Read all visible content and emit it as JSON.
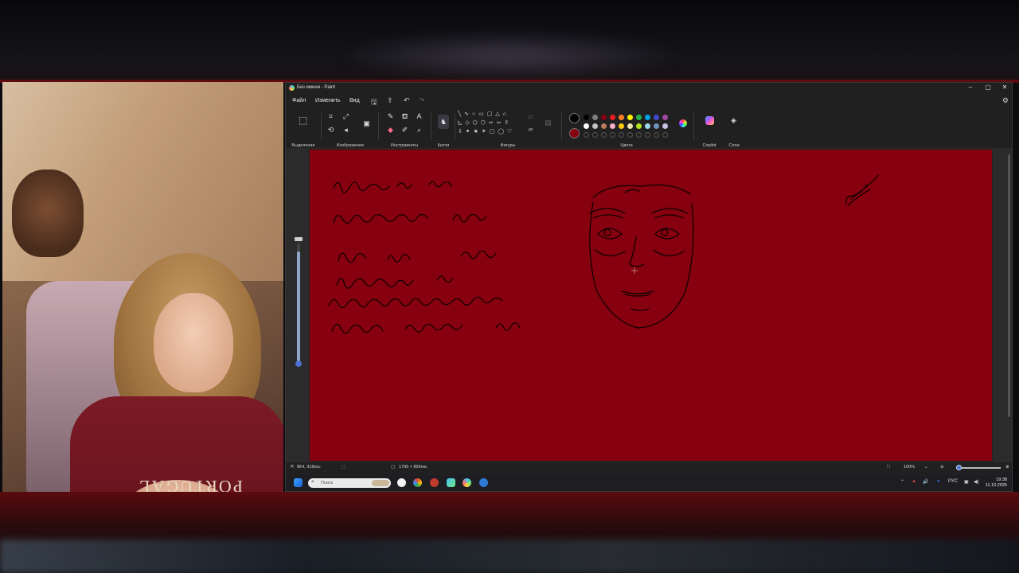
{
  "window": {
    "title": "Без имени - Paint",
    "controls": [
      "–",
      "▢",
      "✕"
    ]
  },
  "menu": {
    "file": "Файл",
    "edit": "Изменить",
    "view": "Вид"
  },
  "ribbon": {
    "groups": {
      "selection": "Выделение",
      "image": "Изображение",
      "tools": "Инструменты",
      "brushes": "Кисти",
      "shapes": "Фигуры",
      "colors": "Цвета",
      "copilot": "Copilot",
      "layers": "Слои"
    },
    "palette_row1": [
      "#000000",
      "#7f7f7f",
      "#880015",
      "#ed1c24",
      "#ff7f27",
      "#fff200",
      "#22b14c",
      "#00a2e8",
      "#3f48cc",
      "#a349a4"
    ],
    "palette_row2": [
      "#ffffff",
      "#c3c3c3",
      "#b97a57",
      "#ffaec9",
      "#ffc90e",
      "#efe4b0",
      "#b5e61d",
      "#99d9ea",
      "#7092be",
      "#c8bfe7"
    ],
    "primary_color": "#000000",
    "secondary_color": "#86000f"
  },
  "canvas": {
    "background": "#86000f"
  },
  "status": {
    "cursor_pos": "854, 318пкс",
    "canvas_size": "1795 × 895пкс",
    "zoom": "100%",
    "zoom_level": 0.0
  },
  "taskbar": {
    "search_placeholder": "Поиск",
    "language": "РУС",
    "time": "19:38",
    "date": "11.10.2025"
  },
  "webcam": {
    "shirt_text": "PORTUGAL"
  }
}
